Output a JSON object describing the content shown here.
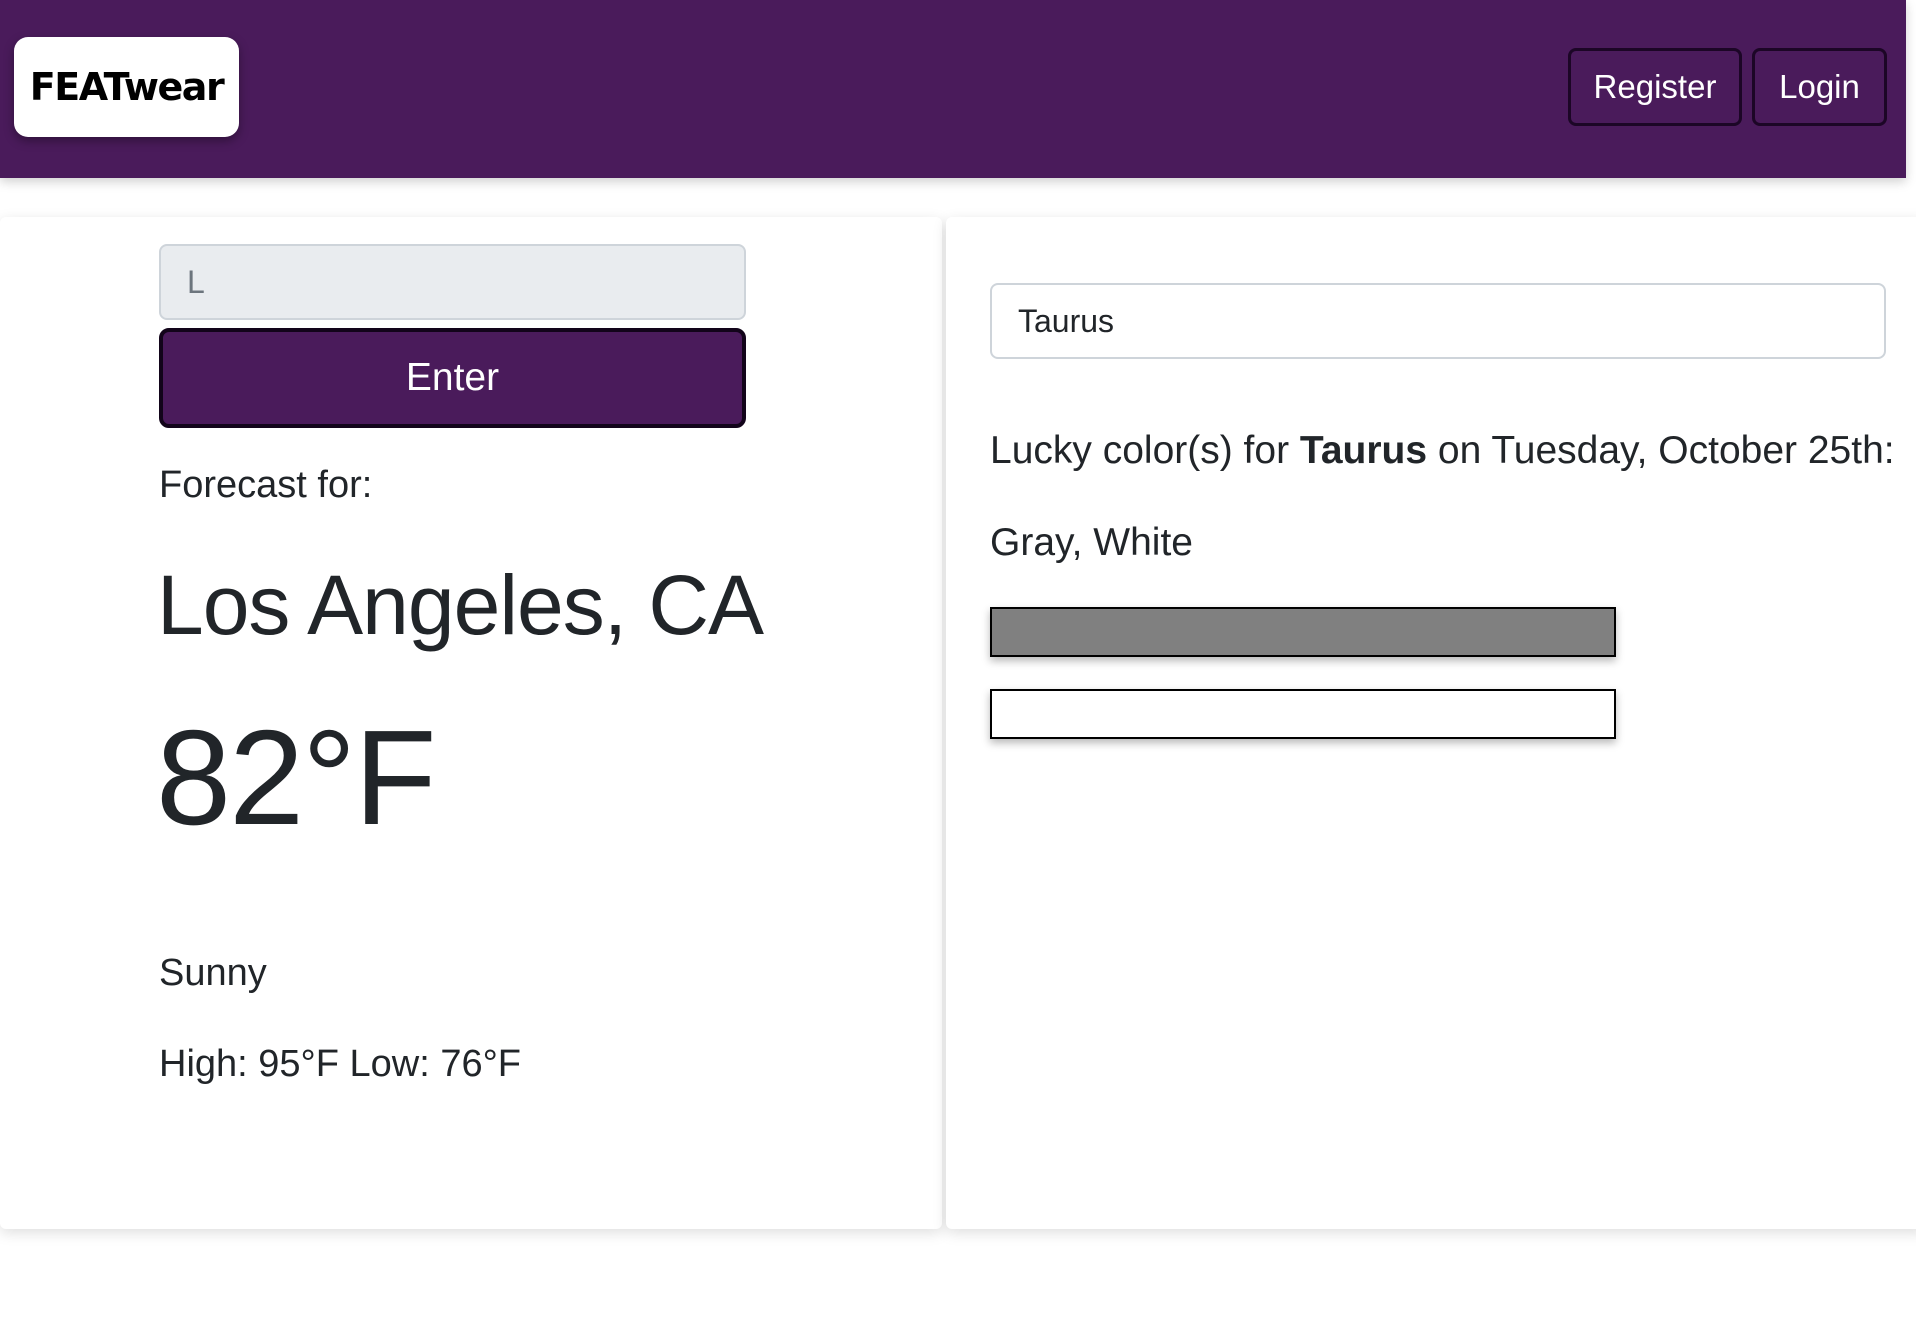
{
  "header": {
    "brand": "FEATwear",
    "register_label": "Register",
    "login_label": "Login",
    "background_color": "#4a1b5b"
  },
  "weather": {
    "location_input_value": "L",
    "enter_label": "Enter",
    "forecast_label": "Forecast for:",
    "city": "Los Angeles, CA",
    "temperature": "82°F",
    "condition": "Sunny",
    "high_low": "High: 95°F Low: 76°F"
  },
  "horoscope": {
    "sign_input_value": "Taurus",
    "lucky_prefix": "Lucky color(s) for ",
    "sign": "Taurus",
    "lucky_suffix": " on Tuesday, October 25th:",
    "colors_text": "Gray, White",
    "swatches": [
      {
        "name": "Gray",
        "color": "#808080"
      },
      {
        "name": "White",
        "color": "#ffffff"
      }
    ]
  }
}
